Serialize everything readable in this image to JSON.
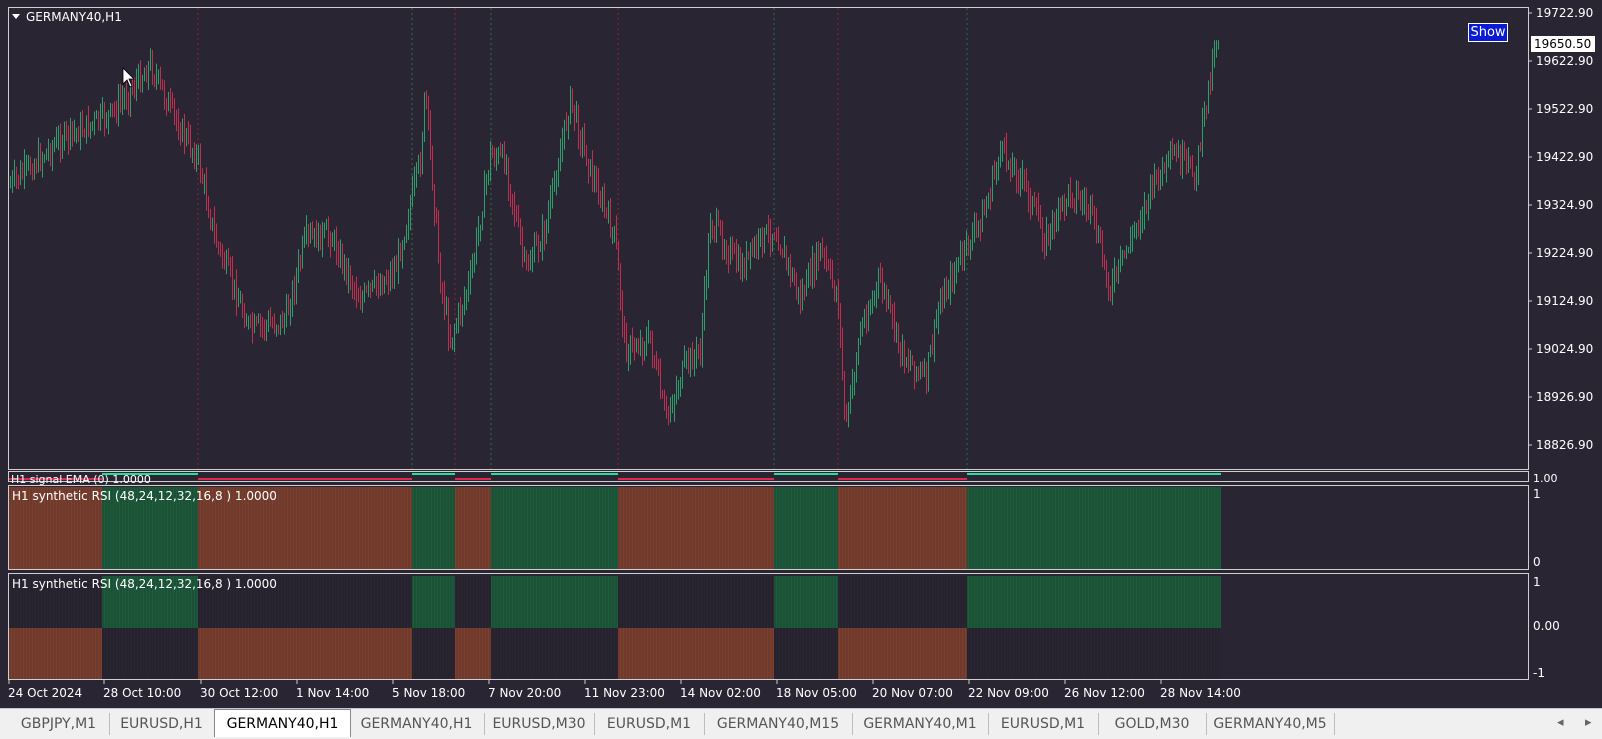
{
  "chart": {
    "title": "GERMANY40,H1",
    "show_label": "Show",
    "current_price": "19650.50",
    "price_ticks": [
      "19722.90",
      "19622.90",
      "19522.90",
      "19422.90",
      "19324.90",
      "19224.90",
      "19124.90",
      "19024.90",
      "18926.90",
      "18826.90"
    ],
    "time_ticks": [
      "24 Oct 2024",
      "28 Oct 10:00",
      "30 Oct 12:00",
      "1 Nov 14:00",
      "5 Nov 18:00",
      "7 Nov 20:00",
      "11 Nov 23:00",
      "14 Nov 02:00",
      "18 Nov 05:00",
      "20 Nov 07:00",
      "22 Nov 09:00",
      "26 Nov 12:00",
      "28 Nov 14:00"
    ],
    "colors": {
      "background": "#2a2533",
      "bull": "#2e9e6a",
      "bear": "#c0304e",
      "rsi_bull": "#1e5a3c",
      "rsi_bear": "#7a4030",
      "ema_bull": "#22e09a",
      "ema_bear": "#e0284e"
    }
  },
  "indicators": {
    "ema_label": "H1 signal EMA (0) 1.0000",
    "ema_scale": "1.00",
    "rsi1_label": "H1 synthetic RSI  (48,24,12,32,16,8 ) 1.0000",
    "rsi1_ticks": [
      "1",
      "0"
    ],
    "rsi2_label": "H1 synthetic RSI  (48,24,12,32,16,8 ) 1.0000",
    "rsi2_ticks": [
      "1",
      "0.00",
      "-1"
    ]
  },
  "tabs": [
    {
      "label": "GBPJPY,M1",
      "active": false
    },
    {
      "label": "EURUSD,H1",
      "active": false
    },
    {
      "label": "GERMANY40,H1",
      "active": true
    },
    {
      "label": "GERMANY40,H1",
      "active": false
    },
    {
      "label": "EURUSD,M30",
      "active": false
    },
    {
      "label": "EURUSD,M1",
      "active": false
    },
    {
      "label": "GERMANY40,M15",
      "active": false
    },
    {
      "label": "GERMANY40,M1",
      "active": false
    },
    {
      "label": "EURUSD,M1",
      "active": false
    },
    {
      "label": "GOLD,M30",
      "active": false
    },
    {
      "label": "GERMANY40,M5",
      "active": false
    }
  ],
  "tab_nav": {
    "left": "◂",
    "right": "▸"
  }
}
